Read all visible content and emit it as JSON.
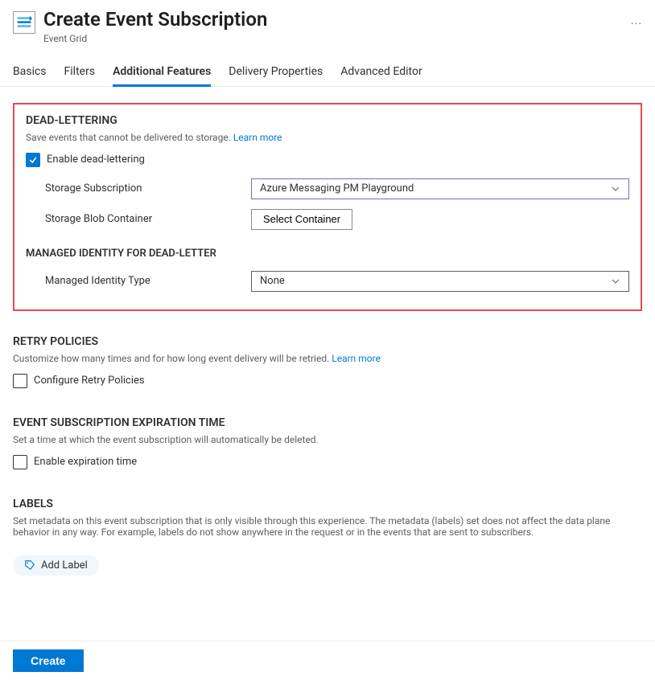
{
  "header": {
    "title": "Create Event Subscription",
    "subtitle": "Event Grid"
  },
  "tabs": [
    {
      "label": "Basics",
      "active": false
    },
    {
      "label": "Filters",
      "active": false
    },
    {
      "label": "Additional Features",
      "active": true
    },
    {
      "label": "Delivery Properties",
      "active": false
    },
    {
      "label": "Advanced Editor",
      "active": false
    }
  ],
  "deadlettering": {
    "title": "DEAD-LETTERING",
    "desc": "Save events that cannot be delivered to storage.",
    "learn_more": "Learn more",
    "enable_label": "Enable dead-lettering",
    "enable_checked": true,
    "storage_subscription_label": "Storage Subscription",
    "storage_subscription_value": "Azure Messaging PM Playground",
    "storage_blob_label": "Storage Blob Container",
    "select_container_label": "Select Container",
    "managed_identity_title": "MANAGED IDENTITY FOR DEAD-LETTER",
    "managed_identity_type_label": "Managed Identity Type",
    "managed_identity_type_value": "None"
  },
  "retry": {
    "title": "RETRY POLICIES",
    "desc": "Customize how many times and for how long event delivery will be retried.",
    "learn_more": "Learn more",
    "checkbox_label": "Configure Retry Policies",
    "checked": false
  },
  "expiration": {
    "title": "EVENT SUBSCRIPTION EXPIRATION TIME",
    "desc": "Set a time at which the event subscription will automatically be deleted.",
    "checkbox_label": "Enable expiration time",
    "checked": false
  },
  "labels": {
    "title": "LABELS",
    "desc": "Set metadata on this event subscription that is only visible through this experience. The metadata (labels) set does not affect the data plane behavior in any way. For example, labels do not show anywhere in the request or in the events that are sent to subscribers.",
    "add_label": "Add Label"
  },
  "footer": {
    "create": "Create"
  }
}
